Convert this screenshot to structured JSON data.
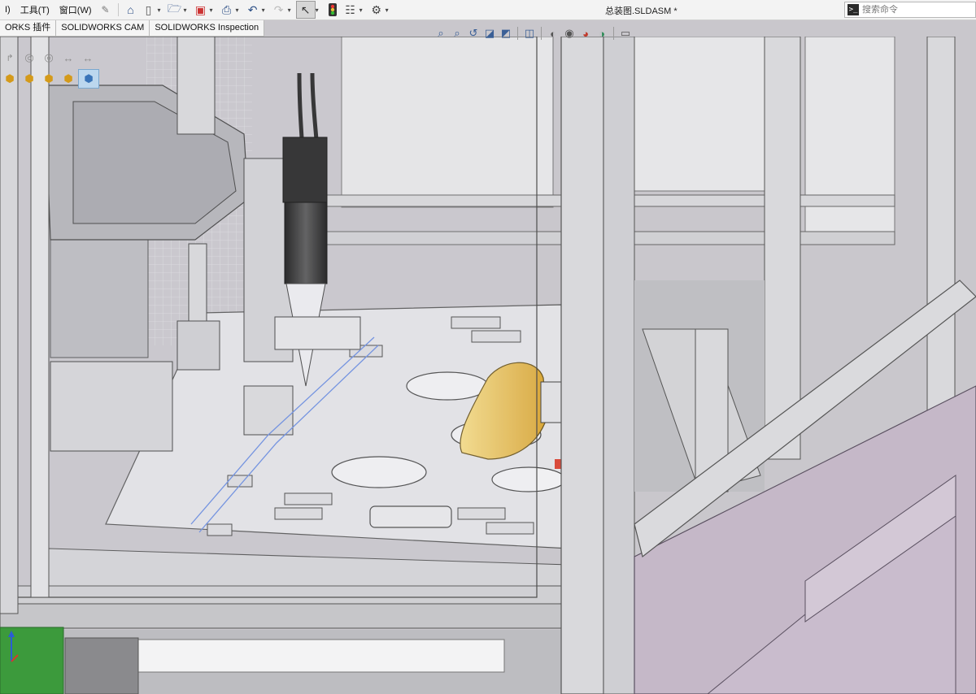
{
  "menu": {
    "items": [
      "I)",
      "工具(T)",
      "窗口(W)"
    ],
    "pin_icon": "pin-icon"
  },
  "toolbar": {
    "icons": [
      "home-icon",
      "new-document-icon",
      "open-folder-icon",
      "save-icon",
      "print-icon",
      "undo-icon",
      "redo-icon",
      "select-pointer-icon",
      "rebuild-traffic-light-icon",
      "file-properties-icon",
      "options-gear-icon"
    ]
  },
  "document": {
    "title": "总装图.SLDASM *"
  },
  "command_search": {
    "placeholder": "搜索命令"
  },
  "command_tabs": [
    "ORKS 插件",
    "SOLIDWORKS CAM",
    "SOLIDWORKS Inspection"
  ],
  "view_toolbar": {
    "icons": [
      "zoom-to-fit-icon",
      "zoom-to-area-icon",
      "previous-view-icon",
      "section-view-icon",
      "dynamic-annotation-icon",
      "view-orientation-icon",
      "display-style-icon",
      "hide-show-items-icon",
      "edit-appearance-icon",
      "apply-scene-icon",
      "view-settings-icon"
    ]
  },
  "colors": {
    "toolbar_bg": "#f3f3f3",
    "viewport_bg": "#c9c7cc",
    "frame_gray": "#c4c4c8",
    "enclosure_purple": "#c5b8c8",
    "gripper_gold": "#e7c35a",
    "board_green": "#3c9a3c",
    "camera_black": "#262626"
  }
}
